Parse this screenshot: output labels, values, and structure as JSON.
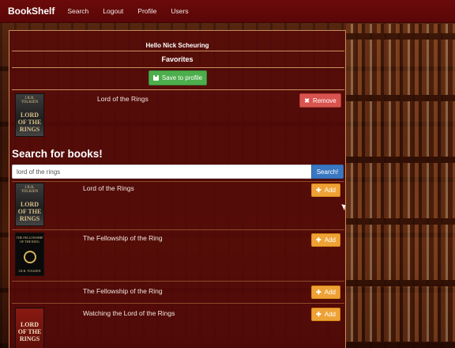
{
  "navbar": {
    "brand": "BookShelf",
    "links": [
      "Search",
      "Logout",
      "Profile",
      "Users"
    ]
  },
  "greeting": "Hello Nick Scheuring",
  "favorites": {
    "title": "Favorites",
    "save_label": "Save to profile",
    "items": [
      {
        "title": "Lord of the Rings",
        "remove_label": "Remove"
      }
    ]
  },
  "search": {
    "heading": "Search for books!",
    "value": "lord of the rings",
    "button_label": "Search!",
    "add_label": "Add",
    "results": [
      {
        "title": "Lord of the Rings"
      },
      {
        "title": "The Fellowship of the Ring"
      },
      {
        "title": "The Fellowship of the Ring"
      },
      {
        "title": "Watching the Lord of the Rings"
      }
    ]
  },
  "covers": {
    "lotr_author": "J.R.R. TOLKIEN",
    "lotr_title": "LORD OF THE RINGS",
    "fellowship_title": "THE FELLOWSHIP OF THE RING",
    "fellowship_author": "J.R.R. TOLKIEN",
    "watching_title": "LORD OF THE RINGS"
  },
  "colors": {
    "navbar": "#5a0707",
    "panel": "#580a08",
    "save": "#4cae4c",
    "remove": "#d9534f",
    "add": "#eea236",
    "search_button": "#3a78c2"
  }
}
